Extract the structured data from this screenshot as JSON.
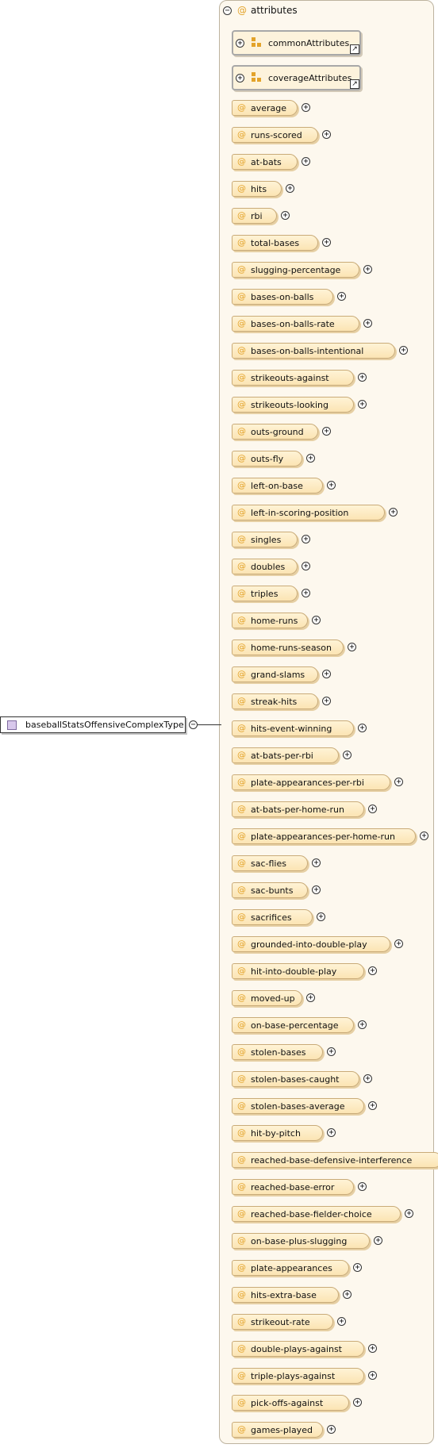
{
  "root": {
    "label": "baseballStatsOffensiveComplexType",
    "icon": "complex-type-icon",
    "collapse_symbol": "−"
  },
  "attributes_group": {
    "label": "attributes",
    "at_symbol": "@",
    "collapse_symbol": "−"
  },
  "attribute_groups": [
    {
      "name": "commonAttributes",
      "icon": "attribute-group-icon",
      "expand_symbol": "+",
      "link_symbol": "↗"
    },
    {
      "name": "coverageAttributes",
      "icon": "attribute-group-icon",
      "expand_symbol": "+",
      "link_symbol": "↗"
    }
  ],
  "attribute_symbol": "@",
  "expand_symbol": "+",
  "attributes": [
    "average",
    "runs-scored",
    "at-bats",
    "hits",
    "rbi",
    "total-bases",
    "slugging-percentage",
    "bases-on-balls",
    "bases-on-balls-rate",
    "bases-on-balls-intentional",
    "strikeouts-against",
    "strikeouts-looking",
    "outs-ground",
    "outs-fly",
    "left-on-base",
    "left-in-scoring-position",
    "singles",
    "doubles",
    "triples",
    "home-runs",
    "home-runs-season",
    "grand-slams",
    "streak-hits",
    "hits-event-winning",
    "at-bats-per-rbi",
    "plate-appearances-per-rbi",
    "at-bats-per-home-run",
    "plate-appearances-per-home-run",
    "sac-flies",
    "sac-bunts",
    "sacrifices",
    "grounded-into-double-play",
    "hit-into-double-play",
    "moved-up",
    "on-base-percentage",
    "stolen-bases",
    "stolen-bases-caught",
    "stolen-bases-average",
    "hit-by-pitch",
    "reached-base-defensive-interference",
    "reached-base-error",
    "reached-base-fielder-choice",
    "on-base-plus-slugging",
    "plate-appearances",
    "hits-extra-base",
    "strikeout-rate",
    "double-plays-against",
    "triple-plays-against",
    "pick-offs-against",
    "games-played"
  ],
  "colors": {
    "panel_background": "#fdf8ee",
    "attribute_fill": "#fbe4b3",
    "attribute_symbol": "#e3a32a",
    "type_icon": "#d8c8ec"
  }
}
